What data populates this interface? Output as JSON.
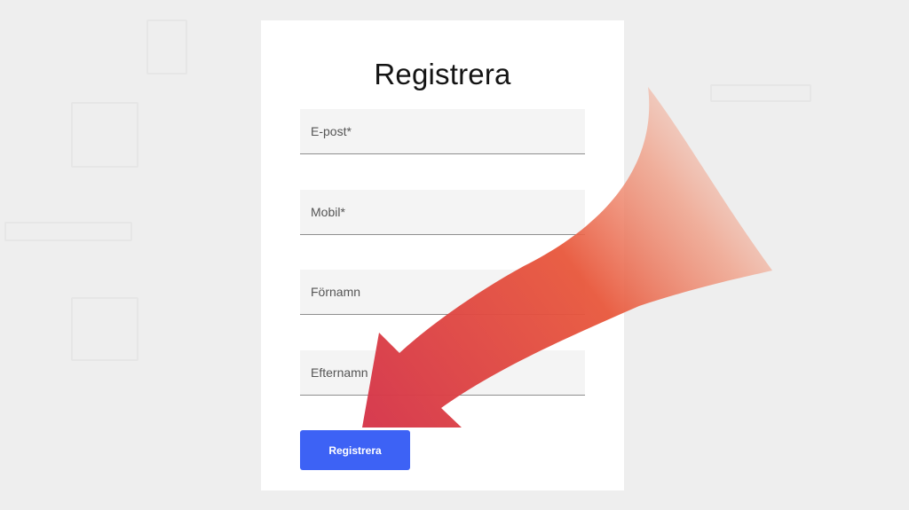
{
  "form": {
    "title": "Registrera",
    "fields": [
      {
        "placeholder": "E-post*",
        "value": ""
      },
      {
        "placeholder": "Mobil*",
        "value": ""
      },
      {
        "placeholder": "Förnamn",
        "value": ""
      },
      {
        "placeholder": "Efternamn",
        "value": ""
      }
    ],
    "submit_label": "Registrera"
  },
  "annotation": {
    "icon": "pointing-arrow-icon",
    "colors": {
      "start": "#f09a80",
      "mid": "#e8573b",
      "end": "#d6374a"
    }
  },
  "colors": {
    "background": "#eeeeee",
    "card": "#ffffff",
    "field_background": "#f4f4f4",
    "button": "#3d62f5"
  }
}
